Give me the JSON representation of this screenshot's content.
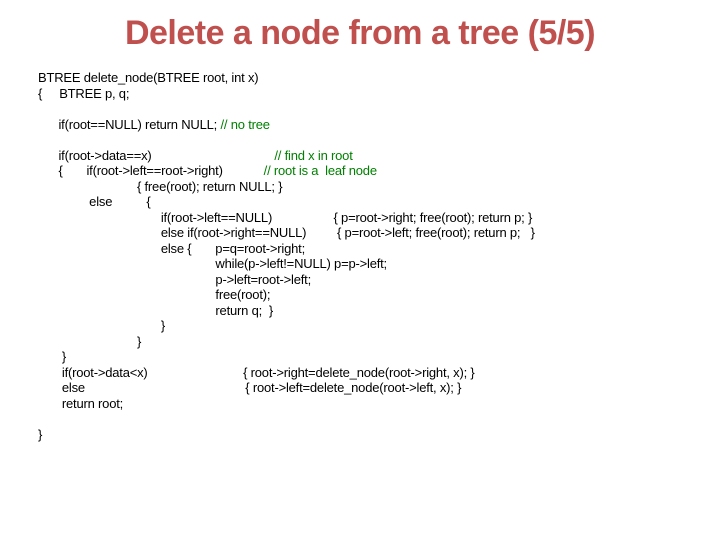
{
  "title": "Delete a node from a tree (5/5)",
  "code": {
    "l01": "BTREE delete_node(BTREE root, int x)",
    "l02": "{     BTREE p, q;",
    "l03": "",
    "l04a": "      if(root==NULL) return NULL; ",
    "l04c": "// no tree",
    "l05": "",
    "l06a": "      if(root->data==x)                                    ",
    "l06c": "// find x in root",
    "l07a": "      {       if(root->left==root->right)            ",
    "l07c": "// root is a  leaf node",
    "l08": "                             { free(root); return NULL; }",
    "l09": "               else          {",
    "l10": "                                    if(root->left==NULL)                  { p=root->right; free(root); return p; }",
    "l11": "                                    else if(root->right==NULL)         { p=root->left; free(root); return p;   }",
    "l12": "                                    else {       p=q=root->right;",
    "l13": "                                                    while(p->left!=NULL) p=p->left;",
    "l14": "                                                    p->left=root->left;",
    "l15": "                                                    free(root);",
    "l16": "                                                    return q;  }",
    "l17": "                                    }",
    "l18": "                             }",
    "l19": "       }",
    "l20": "       if(root->data<x)                            { root->right=delete_node(root->right, x); }",
    "l21": "       else                                               { root->left=delete_node(root->left, x); }",
    "l22": "       return root;",
    "l23": "",
    "l24": "}"
  }
}
